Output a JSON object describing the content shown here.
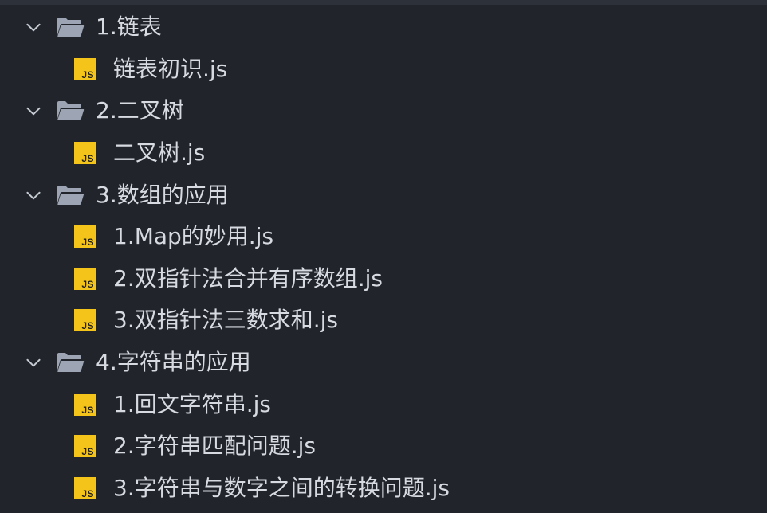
{
  "icons": {
    "chevron": "chevron-down-icon",
    "folder": "folder-open-icon",
    "file": "javascript-file-icon",
    "file_badge": "JS"
  },
  "colors": {
    "background": "#21252b",
    "text": "#d7dae0",
    "folder_icon": "#9da5b4",
    "js_icon_bg": "#f5c41b"
  },
  "tree": [
    {
      "label": "1.链表",
      "expanded": true,
      "children": [
        {
          "label": "链表初识.js"
        }
      ]
    },
    {
      "label": "2.二叉树",
      "expanded": true,
      "children": [
        {
          "label": "二叉树.js"
        }
      ]
    },
    {
      "label": "3.数组的应用",
      "expanded": true,
      "children": [
        {
          "label": "1.Map的妙用.js"
        },
        {
          "label": "2.双指针法合并有序数组.js"
        },
        {
          "label": "3.双指针法三数求和.js"
        }
      ]
    },
    {
      "label": "4.字符串的应用",
      "expanded": true,
      "children": [
        {
          "label": "1.回文字符串.js"
        },
        {
          "label": "2.字符串匹配问题.js"
        },
        {
          "label": "3.字符串与数字之间的转换问题.js"
        }
      ]
    }
  ]
}
